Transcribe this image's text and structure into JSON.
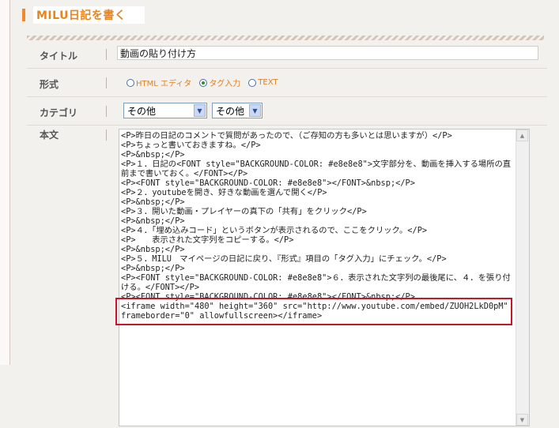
{
  "header": {
    "title": "MILU日記を書く"
  },
  "form": {
    "title_label": "タイトル",
    "title_value": "動画の貼り付け方",
    "format_label": "形式",
    "format_options": [
      {
        "label": "HTML エディタ",
        "checked": false
      },
      {
        "label": "タグ入力",
        "checked": true
      },
      {
        "label": "TEXT",
        "checked": false
      }
    ],
    "category_label": "カテゴリ",
    "category_select_1": "その他",
    "category_select_2": "その他",
    "body_label": "本文"
  },
  "editor": {
    "lines": [
      "<P>昨日の日記のコメントで質問があったので、（ご存知の方も多いとは思いますが）</P>",
      "<P>ちょっと書いておきますね。</P>",
      "<P>&nbsp;</P>",
      "<P>１．日記の<FONT style=\"BACKGROUND-COLOR: #e8e8e8\">文字部分を、動画を挿入する場所の直前まで書いておく。</FONT></P>",
      "<P><FONT style=\"BACKGROUND-COLOR: #e8e8e8\"></FONT>&nbsp;</P>",
      "<P>２．youtubeを開き、好きな動画を選んで開く</P>",
      "<P>&nbsp;</P>",
      "<P>３．開いた動画・プレイヤーの真下の「共有」をクリック</P>",
      "<P>&nbsp;</P>",
      "<P>４．「埋め込みコード」というボタンが表示されるので、ここをクリック。</P>",
      "<P>　　表示された文字列をコピーする。</P>",
      "<P>&nbsp;</P>",
      "<P>５．MILU　マイページの日記に戻り、『形式』項目の「タグ入力」にチェック。</P>",
      "<P>&nbsp;</P>",
      "<P><FONT style=\"BACKGROUND-COLOR: #e8e8e8\">６．表示された文字列の最後尾に、４．を張り付ける。</FONT></P>",
      "<P><FONT style=\"BACKGROUND-COLOR: #e8e8e8\"></FONT>&nbsp;</P>",
      "<iframe width=\"480\" height=\"360\" src=\"http://www.youtube.com/embed/ZUOH2LkD0pM\" frameborder=\"0\" allowfullscreen></iframe>"
    ]
  },
  "colors": {
    "accent": "#f08a2a",
    "highlight": "#c5162b"
  }
}
